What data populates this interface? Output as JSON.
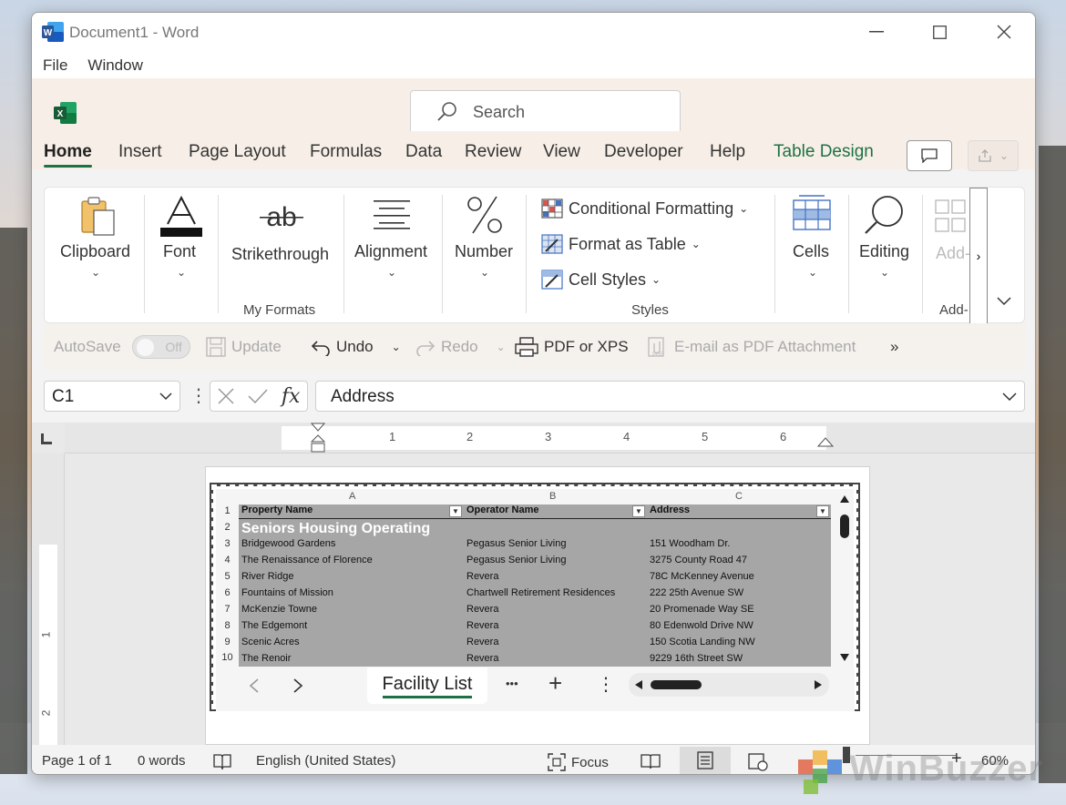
{
  "titlebar": {
    "title": "Document1 - Word"
  },
  "menubar": {
    "items": [
      "File",
      "Window"
    ]
  },
  "search": {
    "placeholder": "Search"
  },
  "tabs": [
    "Home",
    "Insert",
    "Page Layout",
    "Formulas",
    "Data",
    "Review",
    "View",
    "Developer",
    "Help",
    "Table Design"
  ],
  "ribbon": {
    "clipboard": "Clipboard",
    "font": "Font",
    "strikethrough": "Strikethrough",
    "my_formats": "My Formats",
    "alignment": "Alignment",
    "number": "Number",
    "conditional_formatting": "Conditional Formatting",
    "format_as_table": "Format as Table",
    "cell_styles": "Cell Styles",
    "styles": "Styles",
    "cells": "Cells",
    "editing": "Editing",
    "addins": "Add-",
    "addins_group": "Add-"
  },
  "qat": {
    "autosave": "AutoSave",
    "toggle": "Off",
    "update": "Update",
    "undo": "Undo",
    "redo": "Redo",
    "pdf_xps": "PDF or XPS",
    "email_pdf": "E-mail as PDF Attachment",
    "more": "»"
  },
  "formula": {
    "namebox": "C1",
    "value": "Address",
    "fx": "fx"
  },
  "ruler": {
    "h_numbers": [
      "1",
      "2",
      "3",
      "4",
      "5",
      "6"
    ],
    "v_numbers": [
      "1",
      "2"
    ]
  },
  "sheet": {
    "columns": [
      "A",
      "B",
      "C"
    ],
    "headers": [
      "Property Name",
      "Operator Name",
      "Address"
    ],
    "title": "Seniors Housing Operating",
    "rows": [
      {
        "num": "3",
        "a": "Bridgewood Gardens",
        "b": "Pegasus Senior Living",
        "c": "151 Woodham Dr."
      },
      {
        "num": "4",
        "a": "The Renaissance of Florence",
        "b": "Pegasus Senior Living",
        "c": "3275 County Road 47"
      },
      {
        "num": "5",
        "a": "River Ridge",
        "b": "Revera",
        "c": "78C McKenney Avenue"
      },
      {
        "num": "6",
        "a": "Fountains of Mission",
        "b": "Chartwell Retirement Residences",
        "c": "222 25th Avenue SW"
      },
      {
        "num": "7",
        "a": "McKenzie Towne",
        "b": "Revera",
        "c": "20 Promenade Way SE"
      },
      {
        "num": "8",
        "a": "The Edgemont",
        "b": "Revera",
        "c": "80 Edenwold Drive NW"
      },
      {
        "num": "9",
        "a": "Scenic Acres",
        "b": "Revera",
        "c": "150 Scotia Landing NW"
      },
      {
        "num": "10",
        "a": "The Renoir",
        "b": "Revera",
        "c": "9229 16th Street SW"
      }
    ],
    "tab_name": "Facility List",
    "more": "•••",
    "add": "+",
    "menu": "⋮"
  },
  "status": {
    "page": "Page 1 of 1",
    "words": "0 words",
    "language": "English (United States)",
    "focus": "Focus",
    "zoom_minus": "−",
    "zoom_plus": "+",
    "zoom": "60%"
  },
  "watermark": "WinBuzzer",
  "colors": {
    "accent": "#1e7145",
    "word_blue": "#2b579a",
    "excel_green": "#1e7145"
  }
}
